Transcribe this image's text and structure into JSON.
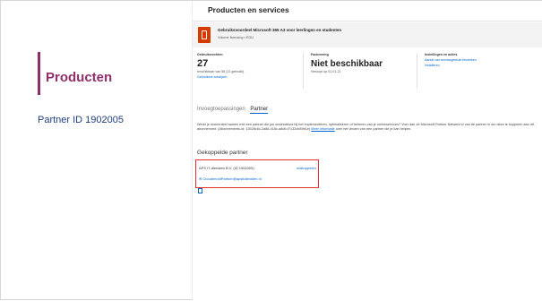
{
  "left": {
    "title": "Producten",
    "partner_id": "Partner ID 1902005"
  },
  "panel": {
    "title": "Producten en services",
    "subscription": {
      "name": "Gebruiksvoordeel Microsoft 365 A3 voor leerlingen en studenten",
      "type": "Volume licensing • EDU",
      "icon": "office-icon"
    },
    "licenses": {
      "title": "Gebruiksrechten",
      "count": "27",
      "detail": "beschikbaar van 58 (23 gebruikt)",
      "link": "Gebruikers toewijzen"
    },
    "billing": {
      "title": "Facturering",
      "status": "Niet beschikbaar",
      "detail": "Verloopt op 01-01-21"
    },
    "settings": {
      "title": "Instellingen en acties",
      "link1": "Aantal van servicegebruik bewerken",
      "link2": "Installeren"
    },
    "tabs": [
      {
        "label": "Invoegtoepassingen",
        "active": false
      },
      {
        "label": "Partner",
        "active": true
      }
    ],
    "description": "Werkt je momenteel samen met een partner die jou ondersteunt bij het implementeren, optimaliseren of beheren van je onlineservices? Voer dan de Microsoft Partner Netwerk id van de partner in om deze te koppelen aan dit abonnement. (Abonnements-id: 13528c6c-2a8d-418c-a8db-f7132cb89b1e)",
    "description_link": "Meer informatie",
    "description_tail": "over het vinden van een partner die je kan helpen.",
    "linked_section_title": "Gekoppelde partner",
    "partner": {
      "name": "APS IT-diensten B.V. (ID 1902005)",
      "unlink": "ontkoppelen",
      "email": "CloudenrollPartner@apsitdiensten.nl",
      "email_prefix": "✉",
      "trash_icon": "trash-icon"
    }
  }
}
